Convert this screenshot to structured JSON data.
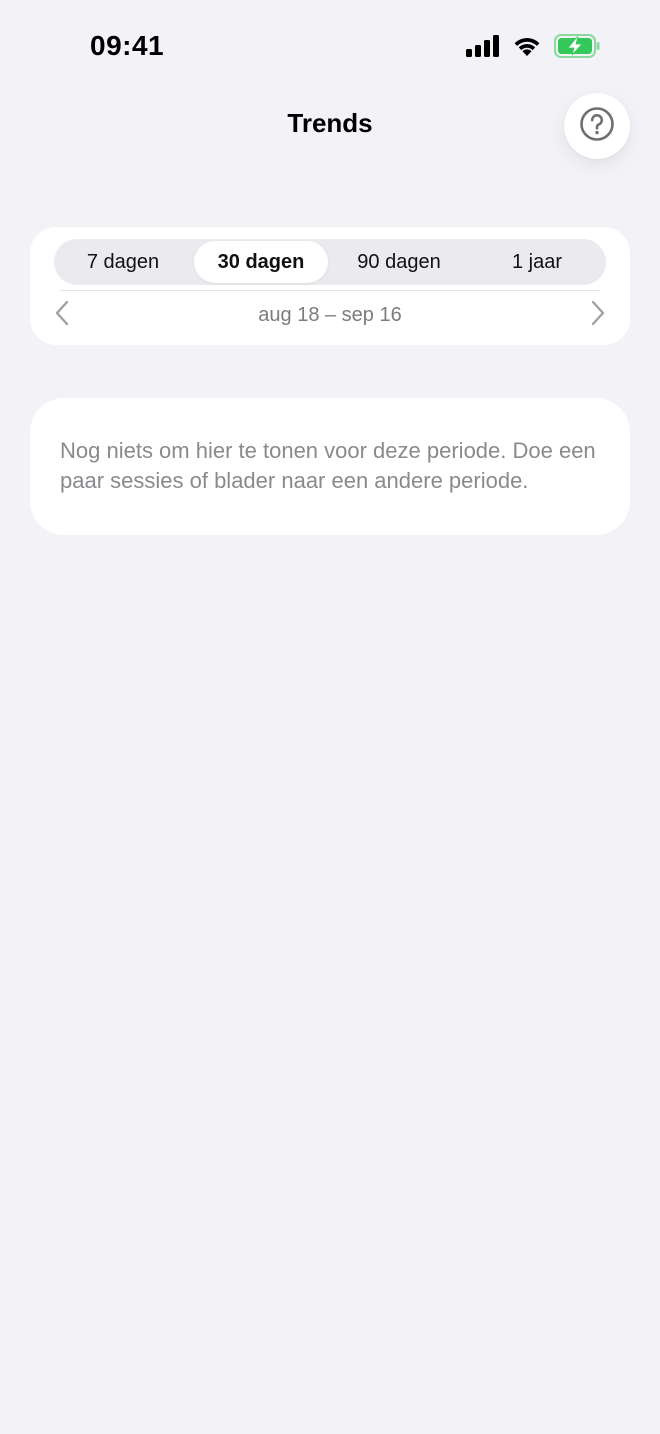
{
  "status_bar": {
    "time": "09:41",
    "icons": [
      "signal-icon",
      "wifi-icon",
      "battery-charging-icon"
    ],
    "battery_color": "#34C759"
  },
  "header": {
    "title": "Trends",
    "help_icon": "question-circle-icon"
  },
  "period_selector": {
    "segments": [
      {
        "label": "7 dagen",
        "selected": false
      },
      {
        "label": "30 dagen",
        "selected": true
      },
      {
        "label": "90 dagen",
        "selected": false
      },
      {
        "label": "1 jaar",
        "selected": false
      }
    ],
    "range_label": "aug 18 – sep 16",
    "prev_icon": "chevron-left-icon",
    "next_icon": "chevron-right-icon"
  },
  "empty_state": {
    "message": "Nog niets om hier te tonen voor deze periode. Doe een paar sessies of blader naar een andere periode."
  },
  "colors": {
    "background": "#F2F2F7",
    "card": "#FFFFFF",
    "secondary_text": "#8A8A8E"
  }
}
